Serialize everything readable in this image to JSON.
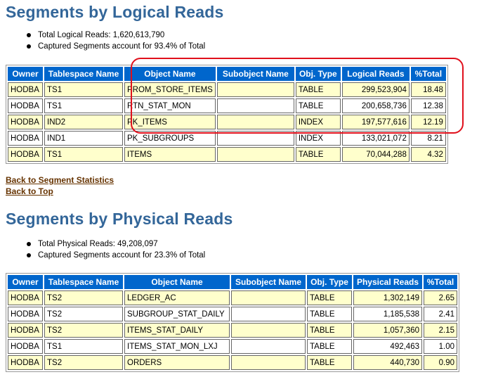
{
  "logical": {
    "title": "Segments by Logical Reads",
    "bullets": [
      "Total Logical Reads: 1,620,613,790",
      "Captured Segments account for 93.4% of Total"
    ],
    "headers": [
      "Owner",
      "Tablespace Name",
      "Object Name",
      "Subobject Name",
      "Obj. Type",
      "Logical Reads",
      "%Total"
    ],
    "rows": [
      [
        "HODBA",
        "TS1",
        "PROM_STORE_ITEMS",
        "",
        "TABLE",
        "299,523,904",
        "18.48"
      ],
      [
        "HODBA",
        "TS1",
        "RTN_STAT_MON",
        "",
        "TABLE",
        "200,658,736",
        "12.38"
      ],
      [
        "HODBA",
        "IND2",
        "PK_ITEMS",
        "",
        "INDEX",
        "197,577,616",
        "12.19"
      ],
      [
        "HODBA",
        "IND1",
        "PK_SUBGROUPS",
        "",
        "INDEX",
        "133,021,072",
        "8.21"
      ],
      [
        "HODBA",
        "TS1",
        "ITEMS",
        "",
        "TABLE",
        "70,044,288",
        "4.32"
      ]
    ]
  },
  "links": {
    "back_segment_stats": "Back to Segment Statistics",
    "back_top": "Back to Top"
  },
  "physical": {
    "title": "Segments by Physical Reads",
    "bullets": [
      "Total Physical Reads: 49,208,097",
      "Captured Segments account for 23.3% of Total"
    ],
    "headers": [
      "Owner",
      "Tablespace Name",
      "Object Name",
      "Subobject Name",
      "Obj. Type",
      "Physical Reads",
      "%Total"
    ],
    "rows": [
      [
        "HODBA",
        "TS2",
        "LEDGER_AC",
        "",
        "TABLE",
        "1,302,149",
        "2.65"
      ],
      [
        "HODBA",
        "TS2",
        "SUBGROUP_STAT_DAILY",
        "",
        "TABLE",
        "1,185,538",
        "2.41"
      ],
      [
        "HODBA",
        "TS2",
        "ITEMS_STAT_DAILY",
        "",
        "TABLE",
        "1,057,360",
        "2.15"
      ],
      [
        "HODBA",
        "TS1",
        "ITEMS_STAT_MON_LXJ",
        "",
        "TABLE",
        "492,463",
        "1.00"
      ],
      [
        "HODBA",
        "TS2",
        "ORDERS",
        "",
        "TABLE",
        "440,730",
        "0.90"
      ]
    ]
  },
  "highlight_color": "#e0101c",
  "header_color": "#0066cc",
  "title_color": "#336699",
  "row_alt_color": "#ffffcc"
}
